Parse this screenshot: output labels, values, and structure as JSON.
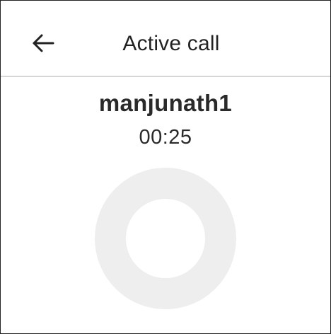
{
  "app_bar": {
    "title": "Active call",
    "back_icon": "arrow-left-icon"
  },
  "call": {
    "caller_name": "manjunath1",
    "duration": "00:25"
  },
  "indicator": {
    "icon": "call-activity-ring-icon",
    "ring_color": "#eeeeee"
  },
  "colors": {
    "text": "#222222",
    "divider": "#d6d6d6",
    "background": "#ffffff"
  }
}
